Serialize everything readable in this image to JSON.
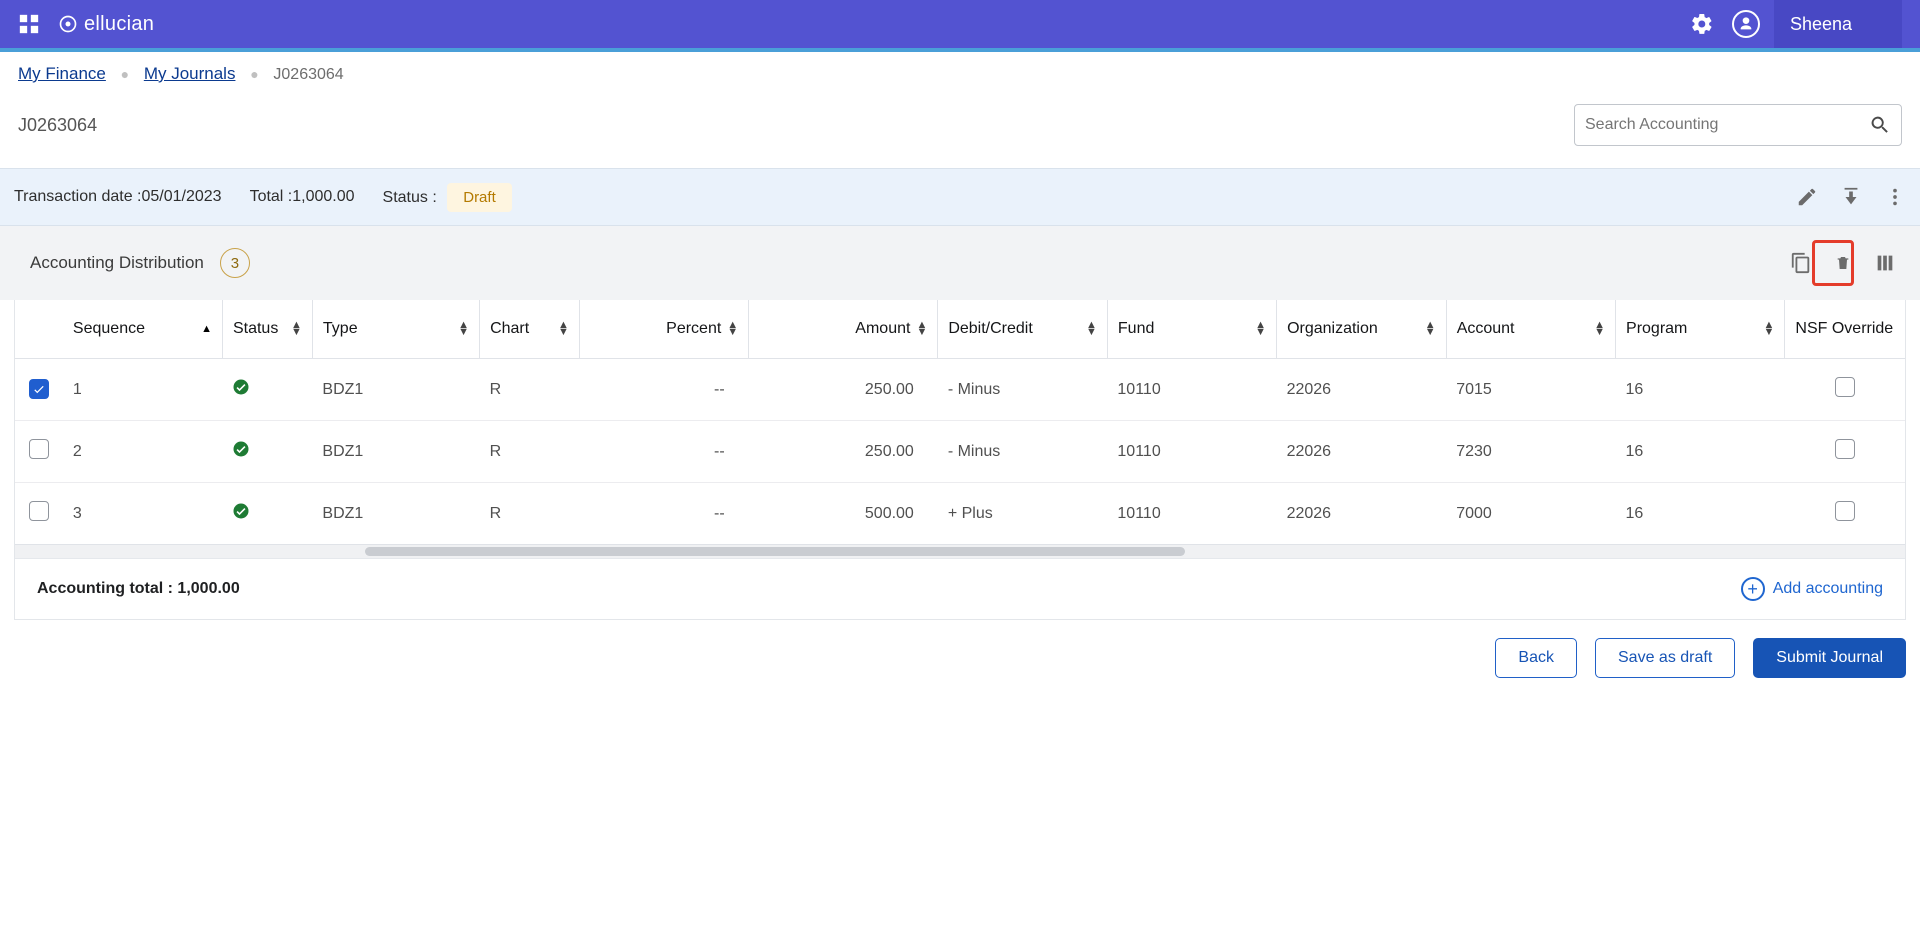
{
  "topbar": {
    "brand": "ellucian",
    "username": "Sheena"
  },
  "breadcrumb": {
    "items": [
      "My Finance",
      "My Journals"
    ],
    "current": "J0263064"
  },
  "page": {
    "title": "J0263064",
    "search_placeholder": "Search Accounting"
  },
  "summary": {
    "transaction_date_label": "Transaction date :",
    "transaction_date_value": "05/01/2023",
    "total_label": "Total :",
    "total_value": "1,000.00",
    "status_label": "Status :",
    "status_value": "Draft"
  },
  "section": {
    "title": "Accounting Distribution",
    "count": "3"
  },
  "table": {
    "columns": {
      "sequence": "Sequence",
      "status": "Status",
      "type": "Type",
      "chart": "Chart",
      "percent": "Percent",
      "amount": "Amount",
      "debit_credit": "Debit/Credit",
      "fund": "Fund",
      "organization": "Organization",
      "account": "Account",
      "program": "Program",
      "nsf_override": "NSF Override"
    },
    "rows": [
      {
        "checked": true,
        "sequence": "1",
        "type": "BDZ1",
        "chart": "R",
        "percent": "--",
        "amount": "250.00",
        "debit_credit": "- Minus",
        "fund": "10110",
        "organization": "22026",
        "account": "7015",
        "program": "16",
        "nsf": false
      },
      {
        "checked": false,
        "sequence": "2",
        "type": "BDZ1",
        "chart": "R",
        "percent": "--",
        "amount": "250.00",
        "debit_credit": "- Minus",
        "fund": "10110",
        "organization": "22026",
        "account": "7230",
        "program": "16",
        "nsf": false
      },
      {
        "checked": false,
        "sequence": "3",
        "type": "BDZ1",
        "chart": "R",
        "percent": "--",
        "amount": "500.00",
        "debit_credit": "+ Plus",
        "fund": "10110",
        "organization": "22026",
        "account": "7000",
        "program": "16",
        "nsf": false
      }
    ],
    "footer_total_label": "Accounting total : 1,000.00",
    "add_label": "Add accounting"
  },
  "actions": {
    "back": "Back",
    "save_draft": "Save as draft",
    "submit": "Submit Journal"
  }
}
